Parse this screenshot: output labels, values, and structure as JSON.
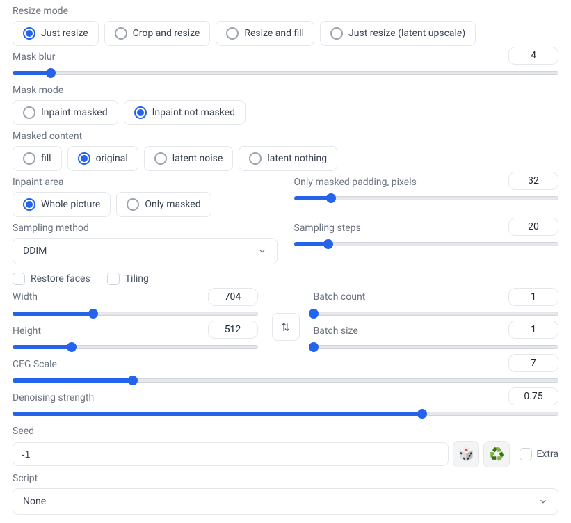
{
  "resize_mode": {
    "label": "Resize mode",
    "options": [
      {
        "label": "Just resize",
        "selected": true
      },
      {
        "label": "Crop and resize",
        "selected": false
      },
      {
        "label": "Resize and fill",
        "selected": false
      },
      {
        "label": "Just resize (latent upscale)",
        "selected": false
      }
    ]
  },
  "mask_blur": {
    "label": "Mask blur",
    "value": "4",
    "pct": 7
  },
  "mask_mode": {
    "label": "Mask mode",
    "options": [
      {
        "label": "Inpaint masked",
        "selected": false
      },
      {
        "label": "Inpaint not masked",
        "selected": true
      }
    ]
  },
  "masked_content": {
    "label": "Masked content",
    "options": [
      {
        "label": "fill",
        "selected": false
      },
      {
        "label": "original",
        "selected": true
      },
      {
        "label": "latent noise",
        "selected": false
      },
      {
        "label": "latent nothing",
        "selected": false
      }
    ]
  },
  "inpaint_area": {
    "label": "Inpaint area",
    "options": [
      {
        "label": "Whole picture",
        "selected": true
      },
      {
        "label": "Only masked",
        "selected": false
      }
    ]
  },
  "only_masked_padding": {
    "label": "Only masked padding, pixels",
    "value": "32",
    "pct": 14
  },
  "sampling_method": {
    "label": "Sampling method",
    "value": "DDIM"
  },
  "sampling_steps": {
    "label": "Sampling steps",
    "value": "20",
    "pct": 13
  },
  "restore_faces": {
    "label": "Restore faces"
  },
  "tiling": {
    "label": "Tiling"
  },
  "width": {
    "label": "Width",
    "value": "704",
    "pct": 33
  },
  "height": {
    "label": "Height",
    "value": "512",
    "pct": 24
  },
  "batch_count": {
    "label": "Batch count",
    "value": "1",
    "pct": 0
  },
  "batch_size": {
    "label": "Batch size",
    "value": "1",
    "pct": 0
  },
  "cfg_scale": {
    "label": "CFG Scale",
    "value": "7",
    "pct": 22
  },
  "denoising_strength": {
    "label": "Denoising strength",
    "value": "0.75",
    "pct": 75
  },
  "seed": {
    "label": "Seed",
    "value": "-1"
  },
  "extra": {
    "label": "Extra"
  },
  "script": {
    "label": "Script",
    "value": "None"
  }
}
